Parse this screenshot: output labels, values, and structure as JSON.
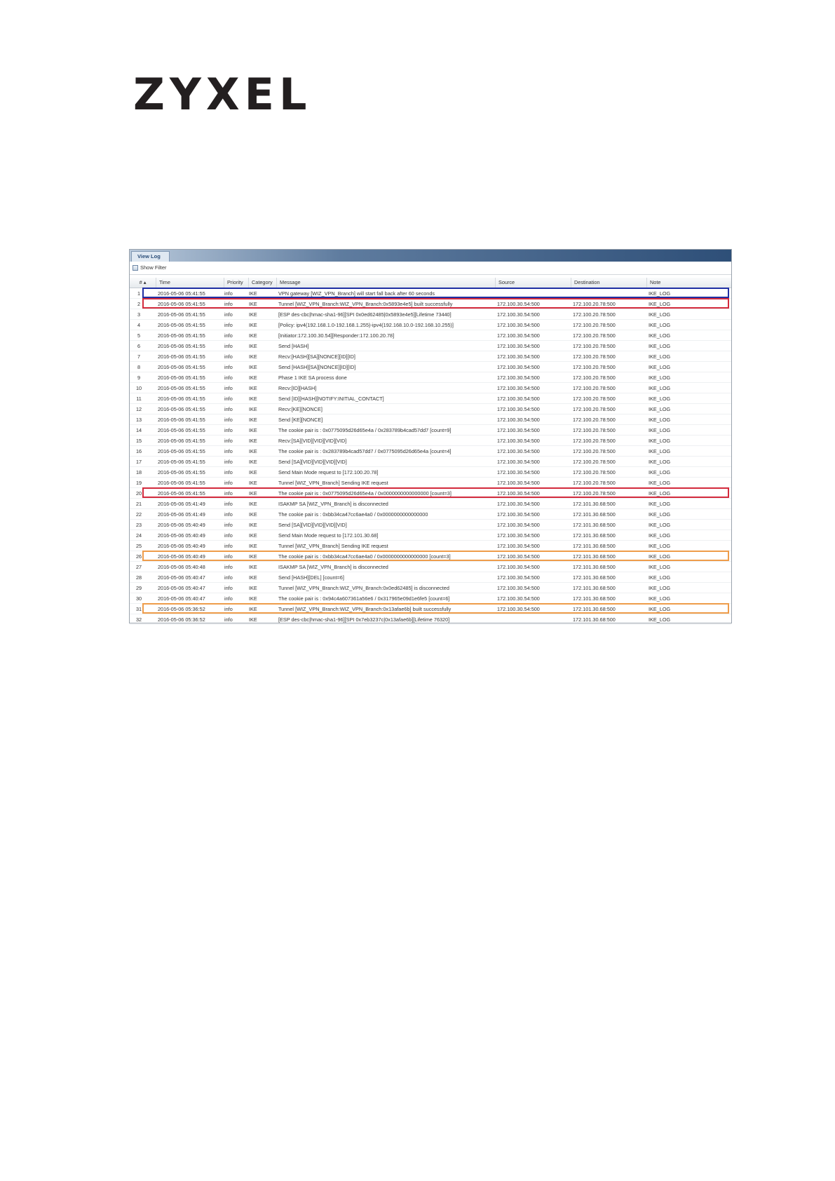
{
  "brand": {
    "logo_text": "ZYXEL"
  },
  "window": {
    "tab_label": "View Log",
    "filter_label": "Show Filter"
  },
  "colors": {
    "highlight_blue": "#1f2fa3",
    "highlight_red": "#d32a3c",
    "highlight_orange": "#ee9c4a",
    "header_bar": "#2e4f78"
  },
  "table": {
    "columns": {
      "num": "#",
      "time": "Time",
      "priority": "Priority",
      "category": "Category",
      "message": "Message",
      "source": "Source",
      "destination": "Destination",
      "note": "Note"
    },
    "rows": [
      {
        "num": "1",
        "time": "2016-05-06 05:41:55",
        "priority": "info",
        "category": "IKE",
        "message": "VPN gateway [WIZ_VPN_Branch] will start fall back after 60 seconds",
        "source": "",
        "destination": "",
        "note": "IKE_LOG"
      },
      {
        "num": "2",
        "time": "2016-05-06 05:41:55",
        "priority": "info",
        "category": "IKE",
        "message": "Tunnel [WIZ_VPN_Branch:WIZ_VPN_Branch:0x5893e4e5] built successfully",
        "source": "172.100.30.54:500",
        "destination": "172.100.20.78:500",
        "note": "IKE_LOG"
      },
      {
        "num": "3",
        "time": "2016-05-06 05:41:55",
        "priority": "info",
        "category": "IKE",
        "message": "[ESP des-cbc|hmac-sha1-96][SPI 0x0ed62485|0x5893e4e5][Lifetime 73440]",
        "source": "172.100.30.54:500",
        "destination": "172.100.20.78:500",
        "note": "IKE_LOG"
      },
      {
        "num": "4",
        "time": "2016-05-06 05:41:55",
        "priority": "info",
        "category": "IKE",
        "message": "[Policy: ipv4(192.168.1.0-192.168.1.255)-ipv4(192.168.10.0-192.168.10.255)]",
        "source": "172.100.30.54:500",
        "destination": "172.100.20.78:500",
        "note": "IKE_LOG"
      },
      {
        "num": "5",
        "time": "2016-05-06 05:41:55",
        "priority": "info",
        "category": "IKE",
        "message": "[Initiator:172.100.30.54][Responder:172.100.20.78]",
        "source": "172.100.30.54:500",
        "destination": "172.100.20.78:500",
        "note": "IKE_LOG"
      },
      {
        "num": "6",
        "time": "2016-05-06 05:41:55",
        "priority": "info",
        "category": "IKE",
        "message": "Send [HASH]",
        "source": "172.100.30.54:500",
        "destination": "172.100.20.78:500",
        "note": "IKE_LOG"
      },
      {
        "num": "7",
        "time": "2016-05-06 05:41:55",
        "priority": "info",
        "category": "IKE",
        "message": "Recv:[HASH][SA][NONCE][ID][ID]",
        "source": "172.100.30.54:500",
        "destination": "172.100.20.78:500",
        "note": "IKE_LOG"
      },
      {
        "num": "8",
        "time": "2016-05-06 05:41:55",
        "priority": "info",
        "category": "IKE",
        "message": "Send [HASH][SA][NONCE][ID][ID]",
        "source": "172.100.30.54:500",
        "destination": "172.100.20.78:500",
        "note": "IKE_LOG"
      },
      {
        "num": "9",
        "time": "2016-05-06 05:41:55",
        "priority": "info",
        "category": "IKE",
        "message": "Phase 1 IKE SA process done",
        "source": "172.100.30.54:500",
        "destination": "172.100.20.78:500",
        "note": "IKE_LOG"
      },
      {
        "num": "10",
        "time": "2016-05-06 05:41:55",
        "priority": "info",
        "category": "IKE",
        "message": "Recv:[ID][HASH]",
        "source": "172.100.30.54:500",
        "destination": "172.100.20.78:500",
        "note": "IKE_LOG"
      },
      {
        "num": "11",
        "time": "2016-05-06 05:41:55",
        "priority": "info",
        "category": "IKE",
        "message": "Send [ID][HASH][NOTIFY:INITIAL_CONTACT]",
        "source": "172.100.30.54:500",
        "destination": "172.100.20.78:500",
        "note": "IKE_LOG"
      },
      {
        "num": "12",
        "time": "2016-05-06 05:41:55",
        "priority": "info",
        "category": "IKE",
        "message": "Recv:[KE][NONCE]",
        "source": "172.100.30.54:500",
        "destination": "172.100.20.78:500",
        "note": "IKE_LOG"
      },
      {
        "num": "13",
        "time": "2016-05-06 05:41:55",
        "priority": "info",
        "category": "IKE",
        "message": "Send [KE][NONCE]",
        "source": "172.100.30.54:500",
        "destination": "172.100.20.78:500",
        "note": "IKE_LOG"
      },
      {
        "num": "14",
        "time": "2016-05-06 05:41:55",
        "priority": "info",
        "category": "IKE",
        "message": "The cookie pair is : 0x0775095d26d65e4a / 0x283789b4cad57dd7 [count=9]",
        "source": "172.100.30.54:500",
        "destination": "172.100.20.78:500",
        "note": "IKE_LOG"
      },
      {
        "num": "15",
        "time": "2016-05-06 05:41:55",
        "priority": "info",
        "category": "IKE",
        "message": "Recv:[SA][VID][VID][VID][VID]",
        "source": "172.100.30.54:500",
        "destination": "172.100.20.78:500",
        "note": "IKE_LOG"
      },
      {
        "num": "16",
        "time": "2016-05-06 05:41:55",
        "priority": "info",
        "category": "IKE",
        "message": "The cookie pair is : 0x283789b4cad57dd7 / 0x0775095d26d65e4a [count=4]",
        "source": "172.100.30.54:500",
        "destination": "172.100.20.78:500",
        "note": "IKE_LOG"
      },
      {
        "num": "17",
        "time": "2016-05-06 05:41:55",
        "priority": "info",
        "category": "IKE",
        "message": "Send [SA][VID][VID][VID][VID]",
        "source": "172.100.30.54:500",
        "destination": "172.100.20.78:500",
        "note": "IKE_LOG"
      },
      {
        "num": "18",
        "time": "2016-05-06 05:41:55",
        "priority": "info",
        "category": "IKE",
        "message": "Send Main Mode request to [172.100.20.78]",
        "source": "172.100.30.54:500",
        "destination": "172.100.20.78:500",
        "note": "IKE_LOG"
      },
      {
        "num": "19",
        "time": "2016-05-06 05:41:55",
        "priority": "info",
        "category": "IKE",
        "message": "Tunnel [WIZ_VPN_Branch] Sending IKE request",
        "source": "172.100.30.54:500",
        "destination": "172.100.20.78:500",
        "note": "IKE_LOG"
      },
      {
        "num": "20",
        "time": "2016-05-06 05:41:55",
        "priority": "info",
        "category": "IKE",
        "message": "The cookie pair is : 0x0775095d26d65e4a / 0x0000000000000000 [count=3]",
        "source": "172.100.30.54:500",
        "destination": "172.100.20.78:500",
        "note": "IKE_LOG"
      },
      {
        "num": "21",
        "time": "2016-05-06 05:41:49",
        "priority": "info",
        "category": "IKE",
        "message": "ISAKMP SA [WIZ_VPN_Branch] is disconnected",
        "source": "172.100.30.54:500",
        "destination": "172.101.30.68:500",
        "note": "IKE_LOG"
      },
      {
        "num": "22",
        "time": "2016-05-06 05:41:49",
        "priority": "info",
        "category": "IKE",
        "message": "The cookie pair is : 0xbb34ca47cc6ae4a0 / 0x0000000000000000",
        "source": "172.100.30.54:500",
        "destination": "172.101.30.68:500",
        "note": "IKE_LOG"
      },
      {
        "num": "23",
        "time": "2016-05-06 05:40:49",
        "priority": "info",
        "category": "IKE",
        "message": "Send [SA][VID][VID][VID][VID]",
        "source": "172.100.30.54:500",
        "destination": "172.101.30.68:500",
        "note": "IKE_LOG"
      },
      {
        "num": "24",
        "time": "2016-05-06 05:40:49",
        "priority": "info",
        "category": "IKE",
        "message": "Send Main Mode request to [172.101.30.68]",
        "source": "172.100.30.54:500",
        "destination": "172.101.30.68:500",
        "note": "IKE_LOG"
      },
      {
        "num": "25",
        "time": "2016-05-06 05:40:49",
        "priority": "info",
        "category": "IKE",
        "message": "Tunnel [WIZ_VPN_Branch] Sending IKE request",
        "source": "172.100.30.54:500",
        "destination": "172.101.30.68:500",
        "note": "IKE_LOG"
      },
      {
        "num": "26",
        "time": "2016-05-06 05:40:49",
        "priority": "info",
        "category": "IKE",
        "message": "The cookie pair is : 0xbb34ca47cc6ae4a0 / 0x0000000000000000 [count=3]",
        "source": "172.100.30.54:500",
        "destination": "172.101.30.68:500",
        "note": "IKE_LOG"
      },
      {
        "num": "27",
        "time": "2016-05-06 05:40:48",
        "priority": "info",
        "category": "IKE",
        "message": "ISAKMP SA [WIZ_VPN_Branch] is disconnected",
        "source": "172.100.30.54:500",
        "destination": "172.101.30.68:500",
        "note": "IKE_LOG"
      },
      {
        "num": "28",
        "time": "2016-05-06 05:40:47",
        "priority": "info",
        "category": "IKE",
        "message": "Send [HASH][DEL] [count=6]",
        "source": "172.100.30.54:500",
        "destination": "172.101.30.68:500",
        "note": "IKE_LOG"
      },
      {
        "num": "29",
        "time": "2016-05-06 05:40:47",
        "priority": "info",
        "category": "IKE",
        "message": "Tunnel [WIZ_VPN_Branch:WIZ_VPN_Branch:0x0ed62485] is disconnected",
        "source": "172.100.30.54:500",
        "destination": "172.101.30.68:500",
        "note": "IKE_LOG"
      },
      {
        "num": "30",
        "time": "2016-05-06 05:40:47",
        "priority": "info",
        "category": "IKE",
        "message": "The cookie pair is : 0x94c4a607361a56e6 / 0x317965e09d1e6fe5 [count=6]",
        "source": "172.100.30.54:500",
        "destination": "172.101.30.68:500",
        "note": "IKE_LOG"
      },
      {
        "num": "31",
        "time": "2016-05-06 05:36:52",
        "priority": "info",
        "category": "IKE",
        "message": "Tunnel [WIZ_VPN_Branch:WIZ_VPN_Branch:0x13afae6b] built successfully",
        "source": "172.100.30.54:500",
        "destination": "172.101.30.68:500",
        "note": "IKE_LOG"
      },
      {
        "num": "32",
        "time": "2016-05-06 05:36:52",
        "priority": "info",
        "category": "IKE",
        "message": "[ESP des-cbc|hmac-sha1-96][SPI 0x7eb3237c|0x13afae6b][Lifetime 76320]",
        "source": "",
        "destination": "172.101.30.68:500",
        "note": "IKE_LOG"
      }
    ]
  }
}
